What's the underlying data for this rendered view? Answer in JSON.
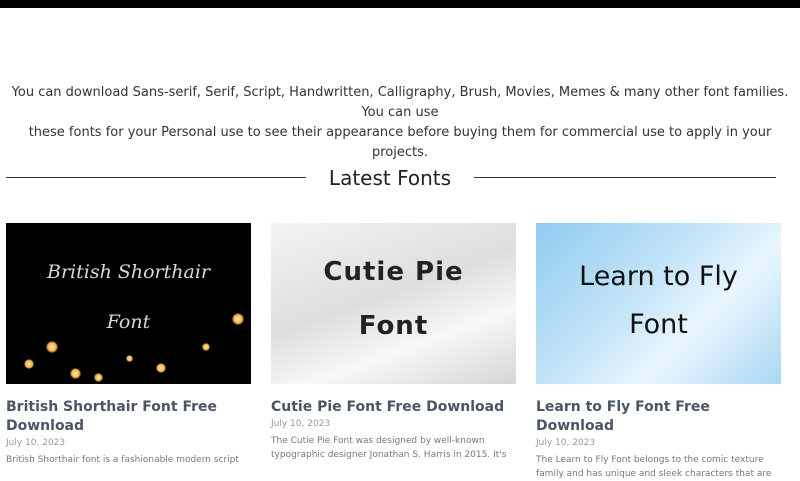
{
  "intro": {
    "line1": "You can download Sans-serif, Serif, Script, Handwritten, Calligraphy, Brush, Movies, Memes & many other font families. You can use",
    "line2": "these fonts for your Personal use to see their appearance before buying them for commercial use to apply in your projects."
  },
  "section": {
    "title": "Latest Fonts"
  },
  "cards": [
    {
      "image_line1": "British Shorthair",
      "image_line2": "Font",
      "title": "British Shorthair Font Free Download",
      "date": "July 10, 2023",
      "excerpt": "British Shorthair font is a fashionable modern script"
    },
    {
      "image_line1": "Cutie Pie",
      "image_line2": "Font",
      "title": "Cutie Pie Font Free Download",
      "date": "July 10, 2023",
      "excerpt": "The Cutie Pie Font was designed by well-known typographic designer Jonathan S. Harris in 2015. It's"
    },
    {
      "image_line1": "Learn to Fly",
      "image_line2": "Font",
      "title": "Learn to Fly Font Free Download",
      "date": "July 10, 2023",
      "excerpt": "The Learn to Fly Font belongs to the comic texture family and has unique and sleek characters that are"
    }
  ],
  "colors": {
    "title": "#4a5566",
    "date": "#999999",
    "rule": "#333333"
  }
}
